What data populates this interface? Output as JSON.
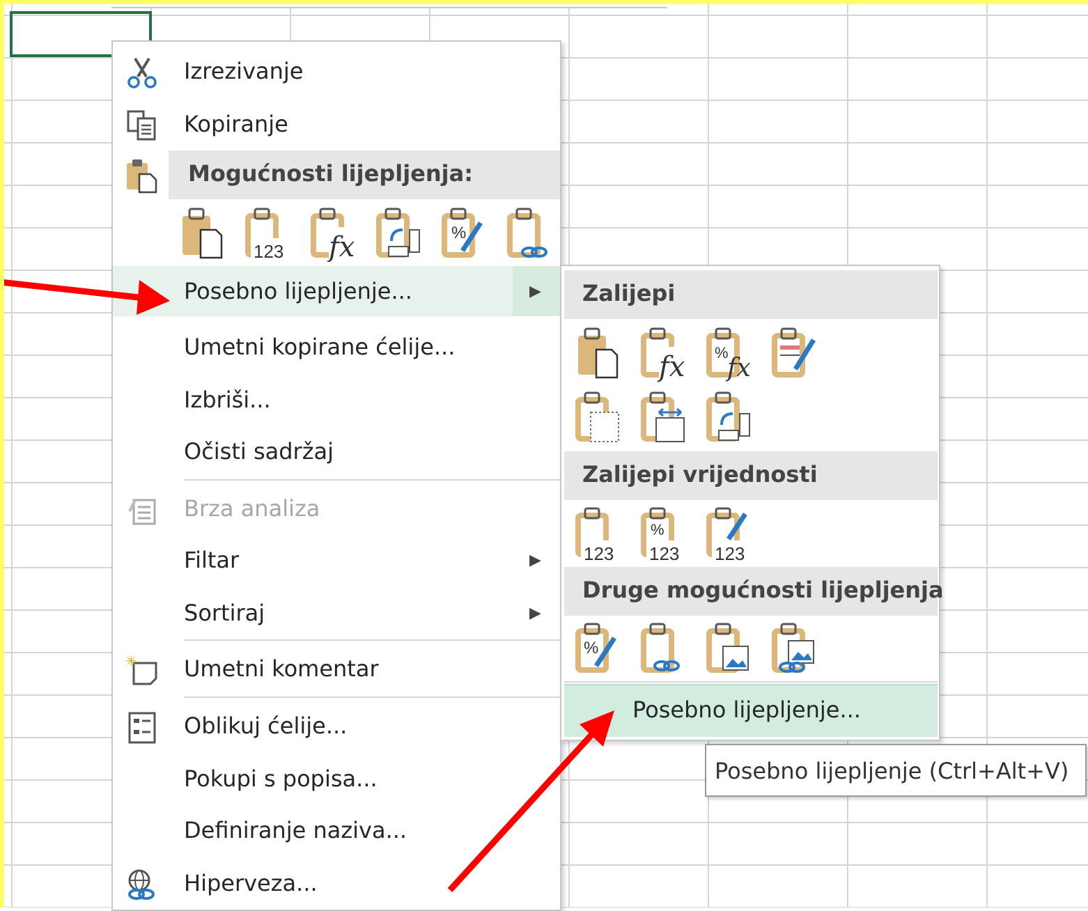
{
  "context_menu": {
    "items": [
      {
        "label": "Izrezivanje",
        "icon": "scissors-icon"
      },
      {
        "label": "Kopiranje",
        "icon": "copy-icon"
      },
      {
        "label": "Mogućnosti lijepljenja:",
        "icon": "paste-icon"
      },
      {
        "label": "Posebno lijepljenje...",
        "icon": ""
      },
      {
        "label": "Umetni kopirane ćelije...",
        "icon": ""
      },
      {
        "label": "Izbriši...",
        "icon": ""
      },
      {
        "label": "Očisti sadržaj",
        "icon": ""
      },
      {
        "label": "Brza analiza",
        "icon": "quick-analysis-icon"
      },
      {
        "label": "Filtar",
        "icon": ""
      },
      {
        "label": "Sortiraj",
        "icon": ""
      },
      {
        "label": "Umetni komentar",
        "icon": "new-comment-icon"
      },
      {
        "label": "Oblikuj ćelije...",
        "icon": "format-cells-icon"
      },
      {
        "label": "Pokupi s popisa...",
        "icon": ""
      },
      {
        "label": "Definiranje naziva...",
        "icon": ""
      },
      {
        "label": "Hiperveza...",
        "icon": "hyperlink-icon"
      }
    ],
    "paste_options": [
      "paste-icon",
      "paste-values-icon",
      "paste-formulas-icon",
      "paste-transpose-icon",
      "paste-formatting-icon",
      "paste-link-icon"
    ],
    "paste_values_label": "123"
  },
  "submenu": {
    "section_paste": "Zalijepi",
    "section_values": "Zalijepi vrijednosti",
    "section_other": "Druge mogućnosti lijepljenja",
    "bottom": "Posebno lijepljenje...",
    "values_label": "123"
  },
  "tooltip": "Posebno lijepljenje (Ctrl+Alt+V)",
  "colors": {
    "accent": "#217346",
    "highlight": "#d2ede0",
    "annotation": "#ff0000",
    "frame": "#ffff66"
  }
}
